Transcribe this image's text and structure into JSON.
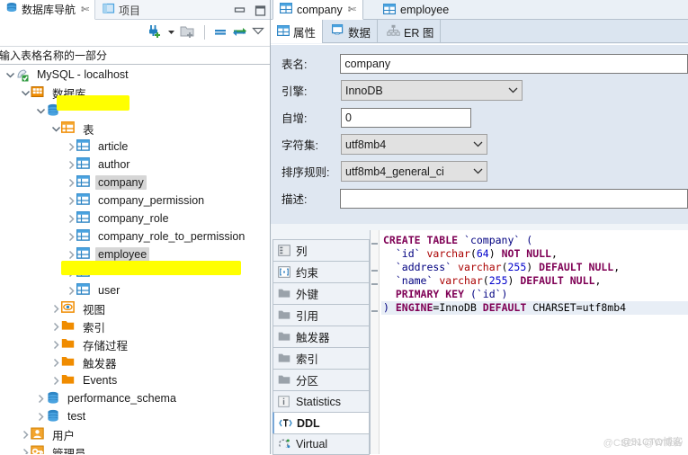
{
  "window": {
    "minimize_label": "minimize",
    "maximize_label": "maximize"
  },
  "left_panel": {
    "tabs": [
      {
        "label": "数据库导航",
        "icon": "database-icon",
        "active": true,
        "closable": true,
        "close_glyph": "✄"
      },
      {
        "label": "项目",
        "icon": "project-folder-icon",
        "active": false,
        "closable": false
      }
    ],
    "toolbar": [
      {
        "name": "new-connection-icon",
        "label": "新建连接"
      },
      {
        "name": "dropdown-arrow-icon",
        "label": "▾"
      },
      {
        "name": "new-folder-icon",
        "label": "新建文件夹"
      },
      {
        "name": "collapse-all-icon",
        "label": "折叠全部"
      },
      {
        "name": "sync-editor-icon",
        "label": "同步编辑器"
      },
      {
        "name": "filter-menu-icon",
        "label": "▽"
      }
    ],
    "search": {
      "placeholder": "输入表格名称的一部分",
      "value": "输入表格名称的一部分"
    },
    "tree": [
      {
        "label": "MySQL - localhost",
        "indent": 0,
        "icon": "connection-icon",
        "expanded": true,
        "selected": false,
        "redacted": false
      },
      {
        "label": "数据库",
        "indent": 1,
        "icon": "databases-folder-icon",
        "expanded": true,
        "selected": false,
        "redacted": false
      },
      {
        "label": "",
        "indent": 2,
        "icon": "schema-icon",
        "expanded": true,
        "selected": false,
        "redacted": true
      },
      {
        "label": "表",
        "indent": 3,
        "icon": "tables-folder-icon",
        "expanded": true,
        "selected": false,
        "redacted": false
      },
      {
        "label": "article",
        "indent": 4,
        "icon": "table-icon",
        "expanded": false,
        "selected": false,
        "redacted": false
      },
      {
        "label": "author",
        "indent": 4,
        "icon": "table-icon",
        "expanded": false,
        "selected": false,
        "redacted": false
      },
      {
        "label": "company",
        "indent": 4,
        "icon": "table-icon",
        "expanded": false,
        "selected": true,
        "redacted": false
      },
      {
        "label": "company_permission",
        "indent": 4,
        "icon": "table-icon",
        "expanded": false,
        "selected": false,
        "redacted": false
      },
      {
        "label": "company_role",
        "indent": 4,
        "icon": "table-icon",
        "expanded": false,
        "selected": false,
        "redacted": false
      },
      {
        "label": "company_role_to_permission",
        "indent": 4,
        "icon": "table-icon",
        "expanded": false,
        "selected": false,
        "redacted": false
      },
      {
        "label": "employee",
        "indent": 4,
        "icon": "table-icon",
        "expanded": false,
        "selected": true,
        "redacted": false
      },
      {
        "label": "",
        "indent": 4,
        "icon": "table-icon",
        "expanded": false,
        "selected": false,
        "redacted": true
      },
      {
        "label": "user",
        "indent": 4,
        "icon": "table-icon",
        "expanded": false,
        "selected": false,
        "redacted": false
      },
      {
        "label": "视图",
        "indent": 3,
        "icon": "views-icon",
        "expanded": false,
        "selected": false,
        "redacted": false
      },
      {
        "label": "索引",
        "indent": 3,
        "icon": "folder-icon",
        "expanded": false,
        "selected": false,
        "redacted": false
      },
      {
        "label": "存储过程",
        "indent": 3,
        "icon": "folder-icon",
        "expanded": false,
        "selected": false,
        "redacted": false
      },
      {
        "label": "触发器",
        "indent": 3,
        "icon": "folder-icon",
        "expanded": false,
        "selected": false,
        "redacted": false
      },
      {
        "label": "Events",
        "indent": 3,
        "icon": "folder-icon",
        "expanded": false,
        "selected": false,
        "redacted": false
      },
      {
        "label": "performance_schema",
        "indent": 2,
        "icon": "schema-icon",
        "expanded": false,
        "selected": false,
        "redacted": false
      },
      {
        "label": "test",
        "indent": 2,
        "icon": "schema-icon",
        "expanded": false,
        "selected": false,
        "redacted": false
      },
      {
        "label": "用户",
        "indent": 1,
        "icon": "users-icon",
        "expanded": false,
        "selected": false,
        "redacted": false
      },
      {
        "label": "管理员",
        "indent": 1,
        "icon": "admin-icon",
        "expanded": false,
        "selected": false,
        "redacted": false
      }
    ]
  },
  "editor": {
    "tabs": [
      {
        "label": "company",
        "icon": "table-icon",
        "active": true,
        "close_glyph": "✄"
      },
      {
        "label": "employee",
        "icon": "table-icon",
        "active": false,
        "close_glyph": ""
      }
    ],
    "sub_tabs": [
      {
        "label": "属性",
        "icon": "properties-icon",
        "active": true
      },
      {
        "label": "数据",
        "icon": "data-grid-icon",
        "active": false
      },
      {
        "label": "ER 图",
        "icon": "er-diagram-icon",
        "active": false
      }
    ],
    "properties": [
      {
        "label": "表名:",
        "value": "company",
        "type": "text",
        "name": "table-name-field"
      },
      {
        "label": "引擎:",
        "value": "InnoDB",
        "type": "select",
        "name": "engine-select"
      },
      {
        "label": "自增:",
        "value": "0",
        "type": "text",
        "name": "auto-increment-field"
      },
      {
        "label": "字符集:",
        "value": "utf8mb4",
        "type": "select",
        "name": "charset-select"
      },
      {
        "label": "排序规则:",
        "value": "utf8mb4_general_ci",
        "type": "select",
        "name": "collation-select"
      },
      {
        "label": "描述:",
        "value": "",
        "type": "text",
        "name": "description-field"
      }
    ],
    "side_tabs": [
      {
        "label": "列",
        "icon": "columns-icon",
        "active": false
      },
      {
        "label": "约束",
        "icon": "constraint-icon",
        "active": false
      },
      {
        "label": "外键",
        "icon": "folder-icon",
        "active": false
      },
      {
        "label": "引用",
        "icon": "folder-icon",
        "active": false
      },
      {
        "label": "触发器",
        "icon": "folder-icon",
        "active": false
      },
      {
        "label": "索引",
        "icon": "folder-icon",
        "active": false
      },
      {
        "label": "分区",
        "icon": "folder-icon",
        "active": false
      },
      {
        "label": "Statistics",
        "icon": "info-icon",
        "active": false
      },
      {
        "label": "DDL",
        "icon": "ddl-icon",
        "active": true
      },
      {
        "label": "Virtual",
        "icon": "virtual-icon",
        "active": false
      }
    ],
    "ddl": {
      "lines": [
        [
          {
            "t": "CREATE TABLE ",
            "c": "kw"
          },
          {
            "t": "`company` (",
            "c": "id"
          }
        ],
        [
          {
            "t": "  `id` ",
            "c": "id"
          },
          {
            "t": "varchar",
            "c": "kw2"
          },
          {
            "t": "(",
            "c": "plain"
          },
          {
            "t": "64",
            "c": "num"
          },
          {
            "t": ") ",
            "c": "plain"
          },
          {
            "t": "NOT NULL",
            "c": "kw"
          },
          {
            "t": ",",
            "c": "plain"
          }
        ],
        [
          {
            "t": "  `address` ",
            "c": "id"
          },
          {
            "t": "varchar",
            "c": "kw2"
          },
          {
            "t": "(",
            "c": "plain"
          },
          {
            "t": "255",
            "c": "num"
          },
          {
            "t": ") ",
            "c": "plain"
          },
          {
            "t": "DEFAULT NULL",
            "c": "kw"
          },
          {
            "t": ",",
            "c": "plain"
          }
        ],
        [
          {
            "t": "  `name` ",
            "c": "id"
          },
          {
            "t": "varchar",
            "c": "kw2"
          },
          {
            "t": "(",
            "c": "plain"
          },
          {
            "t": "255",
            "c": "num"
          },
          {
            "t": ") ",
            "c": "plain"
          },
          {
            "t": "DEFAULT NULL",
            "c": "kw"
          },
          {
            "t": ",",
            "c": "plain"
          }
        ],
        [
          {
            "t": "  PRIMARY KEY ",
            "c": "kw"
          },
          {
            "t": "(`id`)",
            "c": "id"
          }
        ],
        [
          {
            "t": ") ",
            "c": "id"
          },
          {
            "t": "ENGINE",
            "c": "kw"
          },
          {
            "t": "=InnoDB ",
            "c": "plain"
          },
          {
            "t": "DEFAULT",
            "c": "kw"
          },
          {
            "t": " CHARSET=utf8mb4",
            "c": "plain"
          }
        ]
      ],
      "highlight_line": 5
    }
  },
  "watermark": {
    "line1": "@51CTO博客",
    "line2": "@CSDN @Willow"
  },
  "colors": {
    "accent_blue": "#2f7fd0",
    "folder_orange": "#f08c00",
    "panel_blue": "#dfe7f1",
    "highlight_yellow": "#ffff00",
    "selection_gray": "#d6d6d6"
  }
}
